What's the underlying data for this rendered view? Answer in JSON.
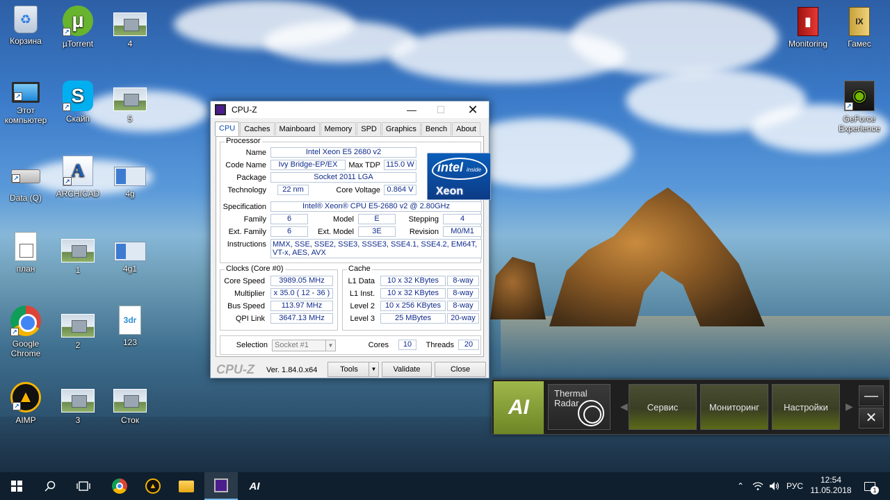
{
  "desktop_icons": [
    {
      "label": "Корзина",
      "icon": "recycle-bin-icon"
    },
    {
      "label": "µTorrent",
      "icon": "utorrent-icon"
    },
    {
      "label": "4",
      "icon": "house-image-icon"
    },
    {
      "label": "Этот компьютер",
      "icon": "computer-icon"
    },
    {
      "label": "Скайп",
      "icon": "skype-icon"
    },
    {
      "label": "5",
      "icon": "house-image-icon"
    },
    {
      "label": "Data (Q)",
      "icon": "drive-icon"
    },
    {
      "label": "ARCHICAD",
      "icon": "archicad-icon"
    },
    {
      "label": "4g",
      "icon": "window-screenshot-icon"
    },
    {
      "label": "план",
      "icon": "document-icon"
    },
    {
      "label": "1",
      "icon": "house-image-icon"
    },
    {
      "label": "4g1",
      "icon": "window-screenshot-icon"
    },
    {
      "label": "Google Chrome",
      "icon": "chrome-icon"
    },
    {
      "label": "2",
      "icon": "house-image-icon"
    },
    {
      "label": "123",
      "icon": "3dr-file-icon"
    },
    {
      "label": "AIMP",
      "icon": "aimp-icon"
    },
    {
      "label": "3",
      "icon": "house-image-icon"
    },
    {
      "label": "Сток",
      "icon": "house-image-icon"
    },
    {
      "label": "Monitoring",
      "icon": "book-icon"
    },
    {
      "label": "Гамес",
      "icon": "book-icon"
    },
    {
      "label": "GeForce Experience",
      "icon": "nvidia-icon"
    }
  ],
  "cpuz": {
    "title": "CPU-Z",
    "tabs": [
      "CPU",
      "Caches",
      "Mainboard",
      "Memory",
      "SPD",
      "Graphics",
      "Bench",
      "About"
    ],
    "active_tab": "CPU",
    "processor": {
      "group_label": "Processor",
      "name_label": "Name",
      "name": "Intel Xeon E5 2680 v2",
      "codename_label": "Code Name",
      "codename": "Ivy Bridge-EP/EX",
      "maxtdp_label": "Max TDP",
      "maxtdp": "115.0 W",
      "package_label": "Package",
      "package": "Socket 2011 LGA",
      "technology_label": "Technology",
      "technology": "22 nm",
      "corevoltage_label": "Core Voltage",
      "corevoltage": "0.864 V",
      "specification_label": "Specification",
      "specification": "Intel® Xeon® CPU E5-2680 v2 @ 2.80GHz",
      "family_label": "Family",
      "family": "6",
      "model_label": "Model",
      "model": "E",
      "stepping_label": "Stepping",
      "stepping": "4",
      "extfamily_label": "Ext. Family",
      "extfamily": "6",
      "extmodel_label": "Ext. Model",
      "extmodel": "3E",
      "revision_label": "Revision",
      "revision": "M0/M1",
      "instructions_label": "Instructions",
      "instructions": "MMX, SSE, SSE2, SSE3, SSSE3, SSE4.1, SSE4.2, EM64T, VT-x, AES, AVX",
      "logo_main": "intel",
      "logo_sub": "inside",
      "logo_brand": "Xeon"
    },
    "clocks": {
      "group_label": "Clocks (Core #0)",
      "corespeed_label": "Core Speed",
      "corespeed": "3989.05 MHz",
      "multiplier_label": "Multiplier",
      "multiplier": "x 35.0 ( 12 - 36 )",
      "busspeed_label": "Bus Speed",
      "busspeed": "113.97 MHz",
      "qpilink_label": "QPI Link",
      "qpilink": "3647.13 MHz"
    },
    "cache": {
      "group_label": "Cache",
      "rows": [
        {
          "label": "L1 Data",
          "size": "10 x 32 KBytes",
          "way": "8-way"
        },
        {
          "label": "L1 Inst.",
          "size": "10 x 32 KBytes",
          "way": "8-way"
        },
        {
          "label": "Level 2",
          "size": "10 x 256 KBytes",
          "way": "8-way"
        },
        {
          "label": "Level 3",
          "size": "25 MBytes",
          "way": "20-way"
        }
      ]
    },
    "selection_label": "Selection",
    "selection": "Socket #1",
    "cores_label": "Cores",
    "cores": "10",
    "threads_label": "Threads",
    "threads": "20",
    "brand": "CPU-Z",
    "version": "Ver. 1.84.0.x64",
    "tools_label": "Tools",
    "validate_label": "Validate",
    "close_label": "Close"
  },
  "gadget": {
    "logo": "AI",
    "radar_title": "Thermal Radar",
    "menu": [
      "Сервис",
      "Мониторинг",
      "Настройки"
    ],
    "minimize": "—",
    "close": "✕"
  },
  "taskbar": {
    "tray_lang": "РУС",
    "time": "12:54",
    "date": "11.05.2018",
    "notif_count": "1"
  },
  "colors": {
    "value_text": "#0f2b8c",
    "tab_active_text": "#0b4fb3",
    "gadget_accent": "#8ca33a",
    "taskbar_bg": "#0f1f2e"
  }
}
